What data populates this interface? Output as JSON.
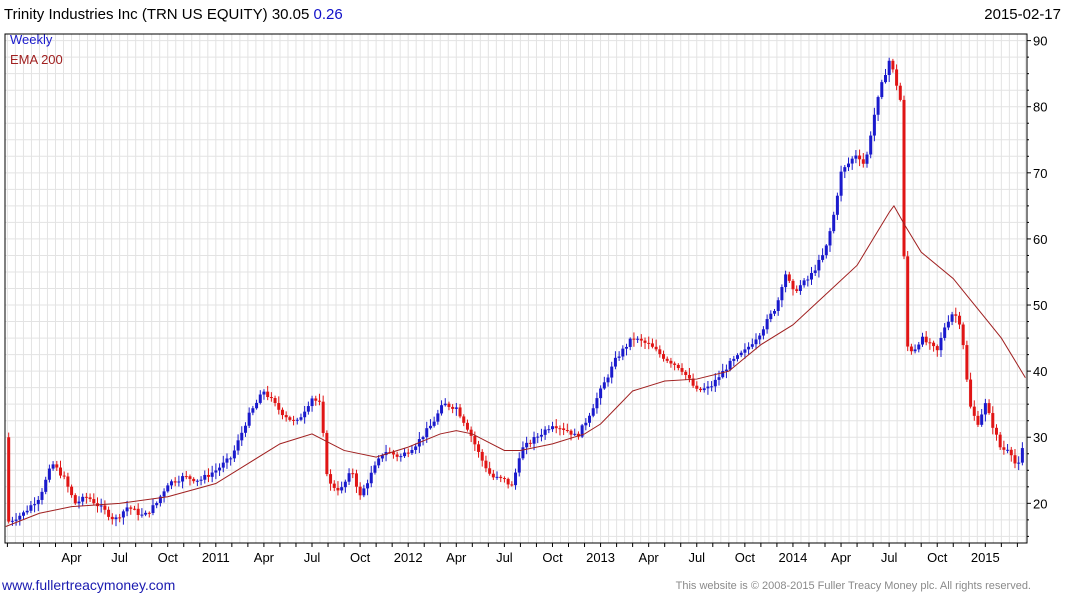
{
  "header": {
    "security": "Trinity Industries Inc (TRN US EQUITY)",
    "price": "30.05",
    "change": "0.26",
    "date": "2015-02-17"
  },
  "legend": {
    "period": "Weekly",
    "indicator": "EMA 200"
  },
  "footer": {
    "site": "www.fullertreacymoney.com",
    "copyright": "This website is © 2008-2015 Fuller Treacy Money plc. All rights reserved."
  },
  "colors": {
    "up": "#1a1acc",
    "down": "#e01515",
    "ema": "#a02020",
    "grid": "#e3e3e3",
    "legend_period": "#1a1acc",
    "legend_ema": "#a02020"
  },
  "chart_data": {
    "type": "candlestick-bars",
    "period": "weekly",
    "ylim": [
      14,
      91
    ],
    "yticks": [
      20,
      30,
      40,
      50,
      60,
      70,
      80,
      90
    ],
    "y_axis_position": "right",
    "grid": true,
    "xlim_month_index": [
      -1.15,
      62.6
    ],
    "x_month_index_origin": "2010-01",
    "xtick_labels": [
      {
        "label": "Apr",
        "m": 3
      },
      {
        "label": "Jul",
        "m": 6
      },
      {
        "label": "Oct",
        "m": 9
      },
      {
        "label": "2011",
        "m": 12
      },
      {
        "label": "Apr",
        "m": 15
      },
      {
        "label": "Jul",
        "m": 18
      },
      {
        "label": "Oct",
        "m": 21
      },
      {
        "label": "2012",
        "m": 24
      },
      {
        "label": "Apr",
        "m": 27
      },
      {
        "label": "Jul",
        "m": 30
      },
      {
        "label": "Oct",
        "m": 33
      },
      {
        "label": "2013",
        "m": 36
      },
      {
        "label": "Apr",
        "m": 39
      },
      {
        "label": "Jul",
        "m": 42
      },
      {
        "label": "Oct",
        "m": 45
      },
      {
        "label": "2014",
        "m": 48
      },
      {
        "label": "Apr",
        "m": 51
      },
      {
        "label": "Jul",
        "m": 54
      },
      {
        "label": "Oct",
        "m": 57
      },
      {
        "label": "2015",
        "m": 60
      }
    ],
    "price_path": [
      [
        -1.1,
        17
      ],
      [
        0,
        18.5
      ],
      [
        1,
        21
      ],
      [
        1.8,
        26
      ],
      [
        2.5,
        24
      ],
      [
        3.2,
        20
      ],
      [
        4,
        21
      ],
      [
        5,
        19
      ],
      [
        5.7,
        17.5
      ],
      [
        6.5,
        19.5
      ],
      [
        7.5,
        18
      ],
      [
        8.3,
        20
      ],
      [
        9,
        23
      ],
      [
        10,
        24
      ],
      [
        11,
        23.5
      ],
      [
        12,
        25
      ],
      [
        13,
        27
      ],
      [
        14,
        33
      ],
      [
        15,
        37
      ],
      [
        16,
        34
      ],
      [
        17,
        32
      ],
      [
        18,
        36
      ],
      [
        18.5,
        35
      ],
      [
        19,
        23
      ],
      [
        19.8,
        22
      ],
      [
        20.5,
        25
      ],
      [
        21,
        21
      ],
      [
        21.6,
        24
      ],
      [
        22.5,
        28
      ],
      [
        23.5,
        27
      ],
      [
        24.5,
        29
      ],
      [
        25.5,
        32
      ],
      [
        26.2,
        35
      ],
      [
        27,
        34.5
      ],
      [
        27.8,
        31
      ],
      [
        28.5,
        27
      ],
      [
        29.2,
        24
      ],
      [
        30,
        23.5
      ],
      [
        30.5,
        22.5
      ],
      [
        31,
        28
      ],
      [
        32,
        30
      ],
      [
        33,
        32
      ],
      [
        34,
        31
      ],
      [
        34.5,
        30
      ],
      [
        35,
        32
      ],
      [
        36,
        37
      ],
      [
        37,
        42
      ],
      [
        38,
        45
      ],
      [
        39,
        44
      ],
      [
        40,
        42
      ],
      [
        41,
        40.5
      ],
      [
        42,
        37
      ],
      [
        42.8,
        37.5
      ],
      [
        43,
        38
      ],
      [
        44,
        41
      ],
      [
        45,
        43
      ],
      [
        46,
        46
      ],
      [
        47,
        50
      ],
      [
        47.5,
        55
      ],
      [
        48,
        52
      ],
      [
        49,
        54
      ],
      [
        50,
        58
      ],
      [
        50.5,
        63
      ],
      [
        51,
        70
      ],
      [
        52,
        73
      ],
      [
        52.5,
        71
      ],
      [
        53,
        78
      ],
      [
        53.5,
        83
      ],
      [
        54,
        87
      ],
      [
        54.3,
        85
      ],
      [
        54.8,
        80
      ],
      [
        55,
        44
      ],
      [
        55.5,
        43
      ],
      [
        56,
        45
      ],
      [
        57,
        43
      ],
      [
        57.5,
        47
      ],
      [
        58,
        49
      ],
      [
        58.5,
        47
      ],
      [
        59,
        35
      ],
      [
        59.5,
        32
      ],
      [
        60,
        35
      ],
      [
        61,
        28
      ],
      [
        61.5,
        28.5
      ],
      [
        62,
        25
      ],
      [
        62.5,
        30
      ]
    ],
    "ema200_path": [
      [
        -1.1,
        16.5
      ],
      [
        1,
        18.5
      ],
      [
        3,
        19.5
      ],
      [
        6,
        20
      ],
      [
        9,
        21
      ],
      [
        12,
        23
      ],
      [
        14,
        26
      ],
      [
        16,
        29
      ],
      [
        18,
        30.5
      ],
      [
        20,
        28
      ],
      [
        22,
        27
      ],
      [
        24,
        28.5
      ],
      [
        26,
        30.5
      ],
      [
        27,
        31
      ],
      [
        28,
        30.5
      ],
      [
        30,
        28
      ],
      [
        31,
        28
      ],
      [
        33,
        29
      ],
      [
        35,
        30.5
      ],
      [
        36,
        32
      ],
      [
        37,
        34.5
      ],
      [
        38,
        37
      ],
      [
        40,
        38.5
      ],
      [
        42,
        38.8
      ],
      [
        44,
        40
      ],
      [
        45,
        42
      ],
      [
        46,
        44
      ],
      [
        48,
        47
      ],
      [
        50,
        51.5
      ],
      [
        52,
        56
      ],
      [
        53,
        60
      ],
      [
        54,
        64
      ],
      [
        54.3,
        65
      ],
      [
        55,
        62
      ],
      [
        56,
        58
      ],
      [
        58,
        54
      ],
      [
        59,
        51
      ],
      [
        60,
        48
      ],
      [
        61,
        45
      ],
      [
        62,
        41
      ],
      [
        62.5,
        39
      ]
    ]
  }
}
